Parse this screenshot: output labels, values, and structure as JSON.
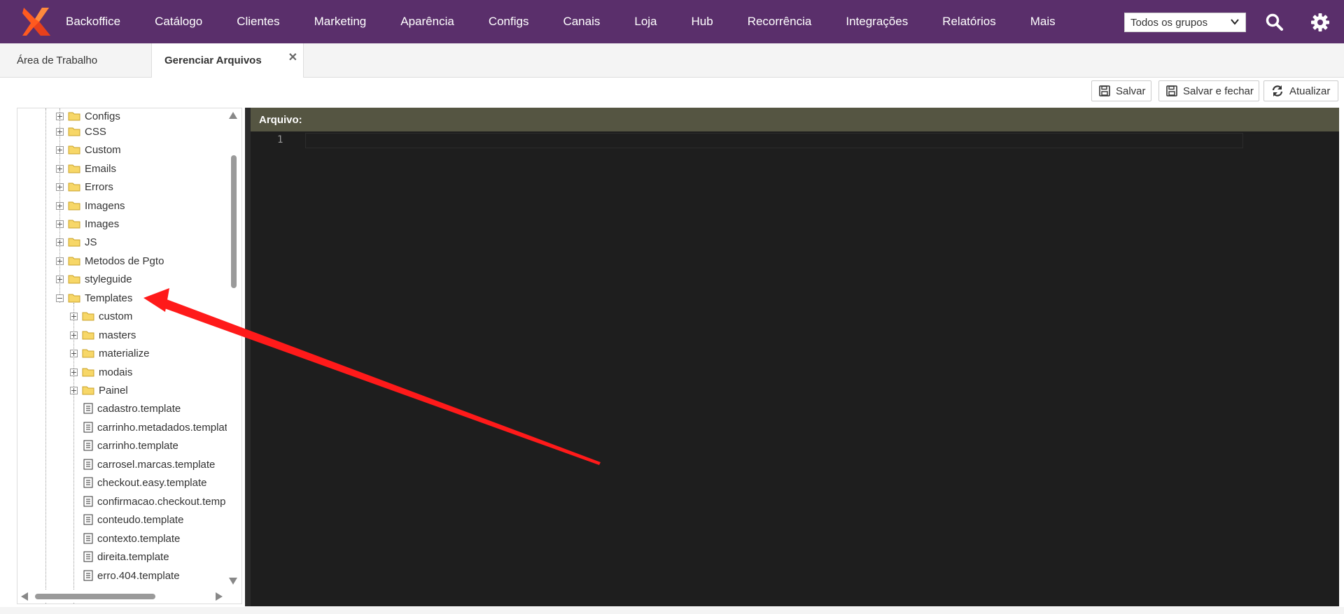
{
  "topbar": {
    "brand": "Backoffice",
    "nav": [
      "Catálogo",
      "Clientes",
      "Marketing",
      "Aparência",
      "Configs",
      "Canais",
      "Loja",
      "Hub",
      "Recorrência",
      "Integrações",
      "Relatórios",
      "Mais"
    ],
    "group_select": "Todos os grupos",
    "bg_color": "#5a2f6b"
  },
  "tabs": {
    "workspace": "Área de Trabalho",
    "active": "Gerenciar Arquivos",
    "close_glyph": "✕"
  },
  "toolbar": {
    "save": "Salvar",
    "save_close": "Salvar e fechar",
    "refresh": "Atualizar"
  },
  "tree": {
    "folders": [
      "Configs",
      "CSS",
      "Custom",
      "Emails",
      "Errors",
      "Imagens",
      "Images",
      "JS",
      "Metodos de Pgto",
      "styleguide",
      "Templates"
    ],
    "template_folders": [
      "custom",
      "masters",
      "materialize",
      "modais",
      "Painel"
    ],
    "template_files": [
      "cadastro.template",
      "carrinho.metadados.templat",
      "carrinho.template",
      "carrosel.marcas.template",
      "checkout.easy.template",
      "confirmacao.checkout.temp",
      "conteudo.template",
      "contexto.template",
      "direita.template",
      "erro.404.template"
    ]
  },
  "editor": {
    "header": "Arquivo:",
    "line_number": "1",
    "header_color": "#555542"
  },
  "icons": {
    "logo": "brand-logo-icon",
    "search": "search-icon",
    "settings": "gear-icon",
    "save": "floppy-icon",
    "refresh": "refresh-icon",
    "folder": "folder-icon",
    "file": "file-icon",
    "annotation": "red-arrow-annotation"
  }
}
